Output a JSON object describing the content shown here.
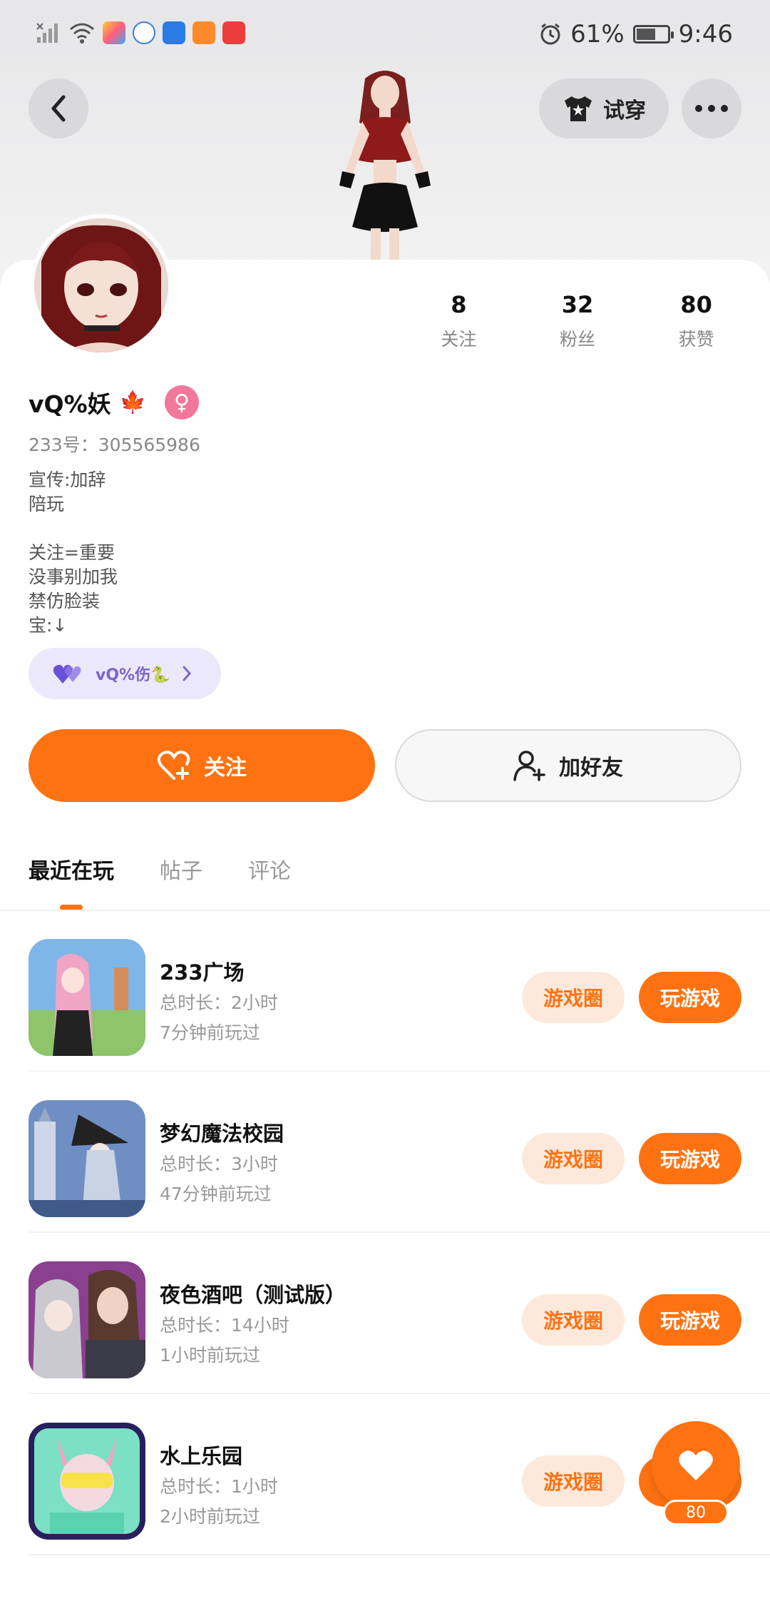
{
  "status_bar": {
    "battery": "61%",
    "time": "9:46",
    "battery_level": 0.61
  },
  "header": {
    "try_on_label": "试穿"
  },
  "profile": {
    "name": "vQ%妖",
    "name_emoji": "🍁",
    "uid": "233号：305565986",
    "bio": "宣传:加辞\n陪玩\n\n关注=重要\n没事别加我\n禁仿脸装\n宝:↓",
    "stats": [
      {
        "value": "8",
        "label": "关注"
      },
      {
        "value": "32",
        "label": "粉丝"
      },
      {
        "value": "80",
        "label": "获赞"
      }
    ],
    "family": {
      "label": "vQ%伤🐍"
    }
  },
  "actions": {
    "follow_label": "关注",
    "add_friend_label": "加好友"
  },
  "tabs": [
    {
      "label": "最近在玩",
      "active": true
    },
    {
      "label": "帖子",
      "active": false
    },
    {
      "label": "评论",
      "active": false
    }
  ],
  "games": [
    {
      "title": "233广场",
      "duration": "总时长：2小时",
      "last_played": "7分钟前玩过",
      "circle_label": "游戏圈",
      "play_label": "玩游戏"
    },
    {
      "title": "梦幻魔法校园",
      "duration": "总时长：3小时",
      "last_played": "47分钟前玩过",
      "circle_label": "游戏圈",
      "play_label": "玩游戏"
    },
    {
      "title": "夜色酒吧（测试版）",
      "duration": "总时长：14小时",
      "last_played": "1小时前玩过",
      "circle_label": "游戏圈",
      "play_label": "玩游戏"
    },
    {
      "title": "水上乐园",
      "duration": "总时长：1小时",
      "last_played": "2小时前玩过",
      "circle_label": "游戏圈",
      "play_label": "玩游戏"
    }
  ],
  "like_fab": {
    "count": "80"
  },
  "colors": {
    "accent": "#ff7212",
    "accent_soft": "#fde9dc",
    "family_bg": "#ece8fb"
  }
}
